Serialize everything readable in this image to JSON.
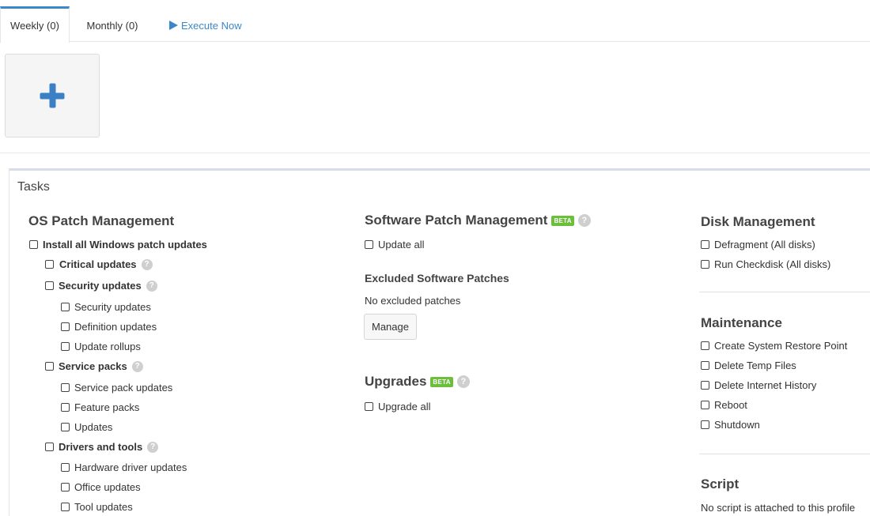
{
  "tabs": {
    "weekly": "Weekly (0)",
    "monthly": "Monthly (0)",
    "execute": "Execute Now"
  },
  "tasks": {
    "title": "Tasks",
    "os_patch": {
      "heading": "OS Patch Management",
      "install_all": "Install all Windows patch updates",
      "critical": "Critical updates",
      "security": "Security updates",
      "security_items": [
        "Security updates",
        "Definition updates",
        "Update rollups"
      ],
      "service_packs": "Service packs",
      "service_pack_items": [
        "Service pack updates",
        "Feature packs",
        "Updates"
      ],
      "drivers": "Drivers and tools",
      "driver_items": [
        "Hardware driver updates",
        "Office updates",
        "Tool updates"
      ]
    },
    "software_patch": {
      "heading": "Software Patch Management",
      "badge": "BETA",
      "update_all": "Update all",
      "excluded_heading": "Excluded Software Patches",
      "excluded_text": "No excluded patches",
      "manage_label": "Manage"
    },
    "upgrades": {
      "heading": "Upgrades",
      "badge": "BETA",
      "upgrade_all": "Upgrade all"
    },
    "disk": {
      "heading": "Disk Management",
      "items": [
        "Defragment (All disks)",
        "Run Checkdisk (All disks)"
      ]
    },
    "maintenance": {
      "heading": "Maintenance",
      "items": [
        "Create System Restore Point",
        "Delete Temp Files",
        "Delete Internet History",
        "Reboot",
        "Shutdown"
      ]
    },
    "script": {
      "heading": "Script",
      "text": "No script is attached to this profile"
    }
  },
  "colors": {
    "accent": "#3b87c8",
    "beta": "#6cbf3b"
  }
}
